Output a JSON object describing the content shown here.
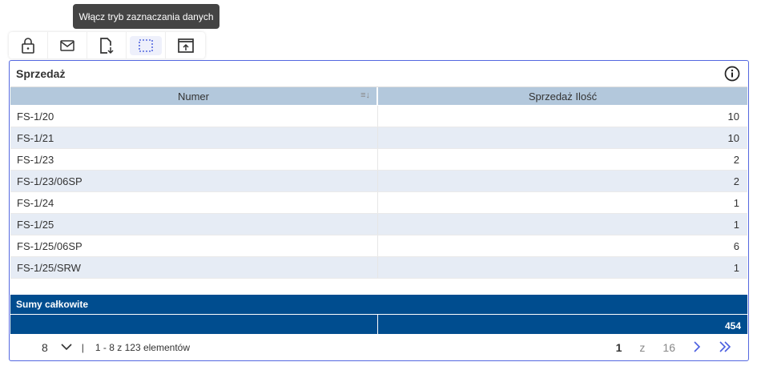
{
  "tooltip": "Włącz tryb zaznaczania danych",
  "toolbar": {
    "icons": [
      "lock-icon",
      "mail-icon",
      "file-download-icon",
      "selection-icon",
      "export-icon"
    ],
    "accent": "#5468e0"
  },
  "panel": {
    "title": "Sprzedaż"
  },
  "table": {
    "columns": [
      "Numer",
      "Sprzedaż Ilość"
    ],
    "rows": [
      [
        "FS-1/20",
        "10"
      ],
      [
        "FS-1/21",
        "10"
      ],
      [
        "FS-1/23",
        "2"
      ],
      [
        "FS-1/23/06SP",
        "2"
      ],
      [
        "FS-1/24",
        "1"
      ],
      [
        "FS-1/25",
        "1"
      ],
      [
        "FS-1/25/06SP",
        "6"
      ],
      [
        "FS-1/25/SRW",
        "1"
      ]
    ]
  },
  "totals": {
    "label": "Sumy całkowite",
    "value": "454"
  },
  "footer": {
    "page_size": "8",
    "separator": "|",
    "range": "1 - 8 z 123 elementów",
    "current_page": "1",
    "of": "z",
    "total_pages": "16"
  }
}
